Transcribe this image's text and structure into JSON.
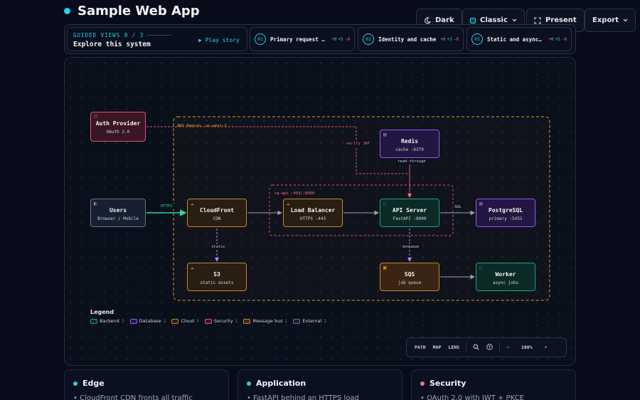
{
  "app": {
    "title": "Sample Web App"
  },
  "topbar": {
    "theme_label": "Dark",
    "style_label": "Classic",
    "present_label": "Present",
    "export_label": "Export"
  },
  "story": {
    "label": "GUIDED VIEWS 0 / 3",
    "title": "Explore this system",
    "play_label": "▶ Play story",
    "steps": [
      {
        "num": "01",
        "label": "Primary request pa…",
        "d1": "+0",
        "d2": "+5",
        "d3": "-0"
      },
      {
        "num": "02",
        "label": "Identity and cache",
        "d1": "+0",
        "d2": "+3",
        "d3": "-0"
      },
      {
        "num": "03",
        "label": "Static and async w…",
        "d1": "+0",
        "d2": "+5",
        "d3": "-0"
      }
    ]
  },
  "diagram": {
    "region_label": "AWS Region: us-west-2",
    "sg_label": "sg-api :443/:8000",
    "nodes": {
      "auth": {
        "name": "Auth Provider",
        "sub": "OAuth 2.0"
      },
      "users": {
        "name": "Users",
        "sub": "Browser / Mobile"
      },
      "cf": {
        "name": "CloudFront",
        "sub": "CDN"
      },
      "lb": {
        "name": "Load Balancer",
        "sub": "HTTPS :443"
      },
      "api": {
        "name": "API Server",
        "sub": "FastAPI :8000"
      },
      "pg": {
        "name": "PostgreSQL",
        "sub": "primary :5432"
      },
      "redis": {
        "name": "Redis",
        "sub": "cache :6379"
      },
      "s3": {
        "name": "S3",
        "sub": "static assets"
      },
      "sqs": {
        "name": "SQS",
        "sub": "job queue"
      },
      "worker": {
        "name": "Worker",
        "sub": "async jobs"
      }
    },
    "edge_labels": {
      "https": "HTTPS",
      "verify": "verify JWT",
      "readthrough": "read-through",
      "sql": "SQL",
      "static": "static",
      "enqueue": "enqueue"
    },
    "colors": {
      "backend": "#1fa37a",
      "database": "#8b5cf6",
      "cloud": "#c6862a",
      "security": "#e0527a",
      "external": "#64748b",
      "region": "#d4a017"
    }
  },
  "legend": {
    "title": "Legend",
    "items": [
      {
        "label": "Backend",
        "count": "3"
      },
      {
        "label": "Database",
        "count": "2"
      },
      {
        "label": "Cloud",
        "count": "3"
      },
      {
        "label": "Security",
        "count": "1"
      },
      {
        "label": "Message bus",
        "count": "1"
      },
      {
        "label": "External",
        "count": "1"
      }
    ]
  },
  "toolbar": {
    "path": "PATH",
    "map": "MAP",
    "lens": "LENS",
    "minus": "−",
    "zoom": "100%",
    "plus": "+"
  },
  "cards": [
    {
      "title": "Edge",
      "body": "• CloudFront CDN fronts all traffic"
    },
    {
      "title": "Application",
      "body": "• FastAPI behind an HTTPS load"
    },
    {
      "title": "Security",
      "body": "• OAuth 2.0 with JWT + PKCE"
    }
  ]
}
